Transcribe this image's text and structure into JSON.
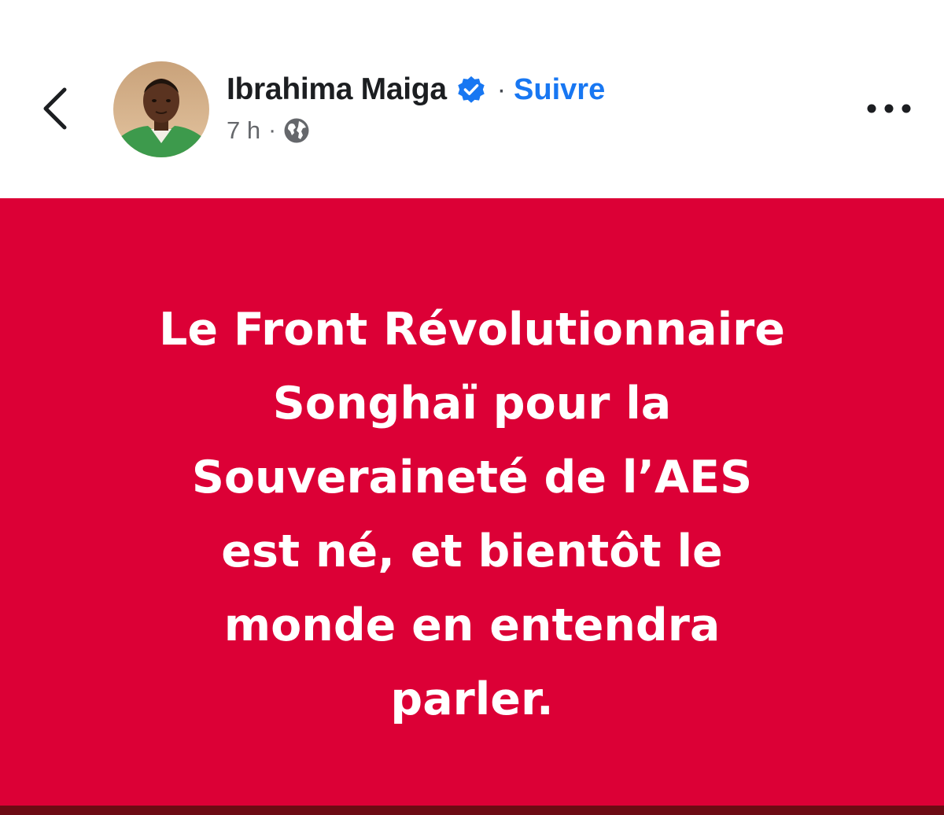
{
  "author": {
    "name": "Ibrahima Maiga",
    "follow_label": "Suivre",
    "separator": "·"
  },
  "meta": {
    "time": "7 h",
    "separator": "·",
    "audience_icon": "globe-icon"
  },
  "post": {
    "lines": [
      "Le Front Révolutionnaire",
      "Songhaï pour la",
      "Souveraineté de l’AES",
      "est né, et bientôt le",
      "monde en entendra",
      "parler."
    ],
    "background_color": "#dc0036",
    "text_color": "#ffffff"
  },
  "icons": {
    "back": "chevron-left-icon",
    "verified": "verified-badge-icon",
    "more": "more-options-icon"
  },
  "colors": {
    "link": "#1877f2",
    "verified": "#1877f2",
    "secondary_text": "#65676b"
  }
}
